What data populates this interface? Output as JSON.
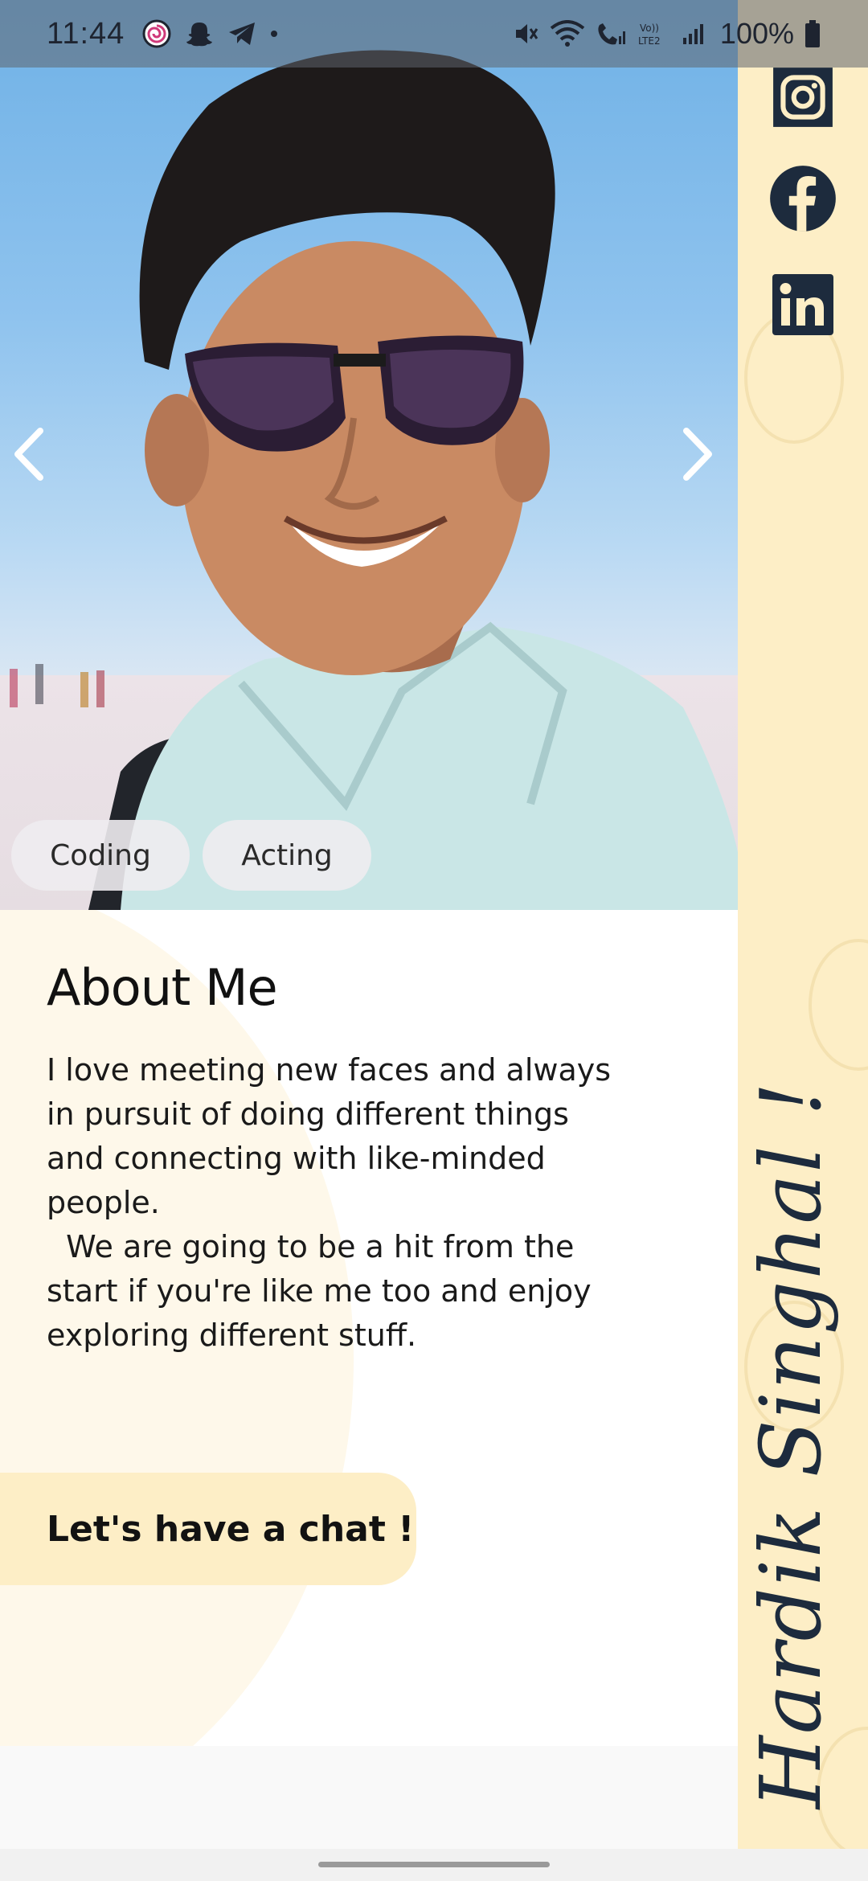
{
  "status_bar": {
    "time": "11:44",
    "battery_percent": "100%",
    "left_icons": [
      "app-spiral-icon",
      "snapchat-icon",
      "telegram-icon",
      "notification-dot"
    ],
    "right_icons": [
      "mute-icon",
      "wifi-icon",
      "wifi-calling-icon",
      "signal-icon",
      "volte-lte2-icon",
      "signal-icon",
      "battery-icon"
    ]
  },
  "profile": {
    "interests": [
      "Coding",
      "Acting"
    ],
    "about_title": "About Me",
    "bio": "I love meeting new faces and always\nin pursuit of doing different things\nand connecting with like-minded\npeople.\n  We are going to be a hit from the\nstart if you're like me too and enjoy\nexploring different stuff.",
    "cta_label": "Let's have a chat !",
    "signature": "Hardik Singhal !"
  },
  "social_links": [
    "instagram-icon",
    "facebook-icon",
    "linkedin-icon"
  ],
  "colors": {
    "accent": "#fdeec6",
    "text_dark": "#1d2b3d",
    "status_bar": "#5f646e"
  }
}
